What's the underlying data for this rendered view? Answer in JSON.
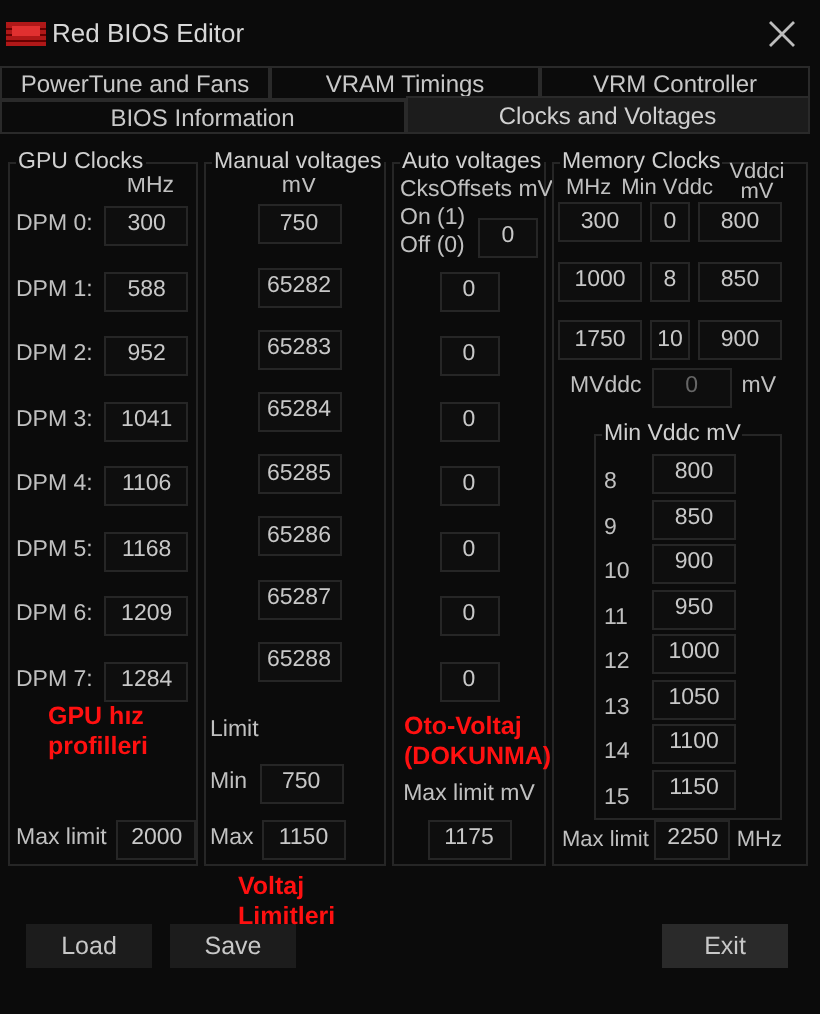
{
  "window": {
    "title": "Red BIOS Editor"
  },
  "tab_rows": [
    [
      {
        "label": "PowerTune and Fans",
        "selected": false
      },
      {
        "label": "VRAM Timings",
        "selected": false
      },
      {
        "label": "VRM Controller",
        "selected": false
      }
    ],
    [
      {
        "label": "BIOS Information",
        "selected": false
      },
      {
        "label": "Clocks and Voltages",
        "selected": true
      }
    ]
  ],
  "gpu_clocks": {
    "title": "GPU Clocks",
    "unit": "MHz",
    "rows": [
      {
        "label": "DPM 0:",
        "value": "300"
      },
      {
        "label": "DPM 1:",
        "value": "588"
      },
      {
        "label": "DPM 2:",
        "value": "952"
      },
      {
        "label": "DPM 3:",
        "value": "1041"
      },
      {
        "label": "DPM 4:",
        "value": "1106"
      },
      {
        "label": "DPM 5:",
        "value": "1168"
      },
      {
        "label": "DPM 6:",
        "value": "1209"
      },
      {
        "label": "DPM 7:",
        "value": "1284"
      }
    ],
    "max_limit": {
      "label": "Max limit",
      "value": "2000"
    }
  },
  "manual_voltages": {
    "title": "Manual voltages",
    "unit": "mV",
    "values": [
      "750",
      "65282",
      "65283",
      "65284",
      "65285",
      "65286",
      "65287",
      "65288"
    ],
    "limit": {
      "title": "Limit",
      "min_label": "Min",
      "min": "750",
      "max_label": "Max",
      "max": "1150"
    }
  },
  "auto_voltages": {
    "title": "Auto voltages",
    "header": "CksOffsets mV",
    "on_label": "On (1)",
    "off_label": "Off (0)",
    "values": [
      "0",
      "0",
      "0",
      "0",
      "0",
      "0",
      "0",
      "0"
    ],
    "max_limit": {
      "label": "Max limit mV",
      "value": "1175"
    }
  },
  "memory_clocks": {
    "title": "Memory Clocks",
    "columns": [
      "MHz",
      "Min Vddc",
      "Vddci mV"
    ],
    "rows": [
      [
        "300",
        "0",
        "800"
      ],
      [
        "1000",
        "8",
        "850"
      ],
      [
        "1750",
        "10",
        "900"
      ]
    ],
    "mvddc": {
      "label": "MVddc",
      "value": "0",
      "unit": "mV",
      "disabled": true
    },
    "min_vddc": {
      "title": "Min Vddc mV",
      "rows": [
        {
          "label": "8",
          "value": "800"
        },
        {
          "label": "9",
          "value": "850"
        },
        {
          "label": "10",
          "value": "900"
        },
        {
          "label": "11",
          "value": "950"
        },
        {
          "label": "12",
          "value": "1000"
        },
        {
          "label": "13",
          "value": "1050"
        },
        {
          "label": "14",
          "value": "1100"
        },
        {
          "label": "15",
          "value": "1150"
        }
      ]
    },
    "max_limit": {
      "label": "Max limit",
      "value": "2250",
      "unit": "MHz"
    }
  },
  "annotations": [
    "GPU hız profilleri",
    "Oto-Voltaj (DOKUNMA)",
    "Voltaj Limitleri"
  ],
  "buttons": [
    "Load",
    "Save"
  ],
  "exit_button": "Exit"
}
